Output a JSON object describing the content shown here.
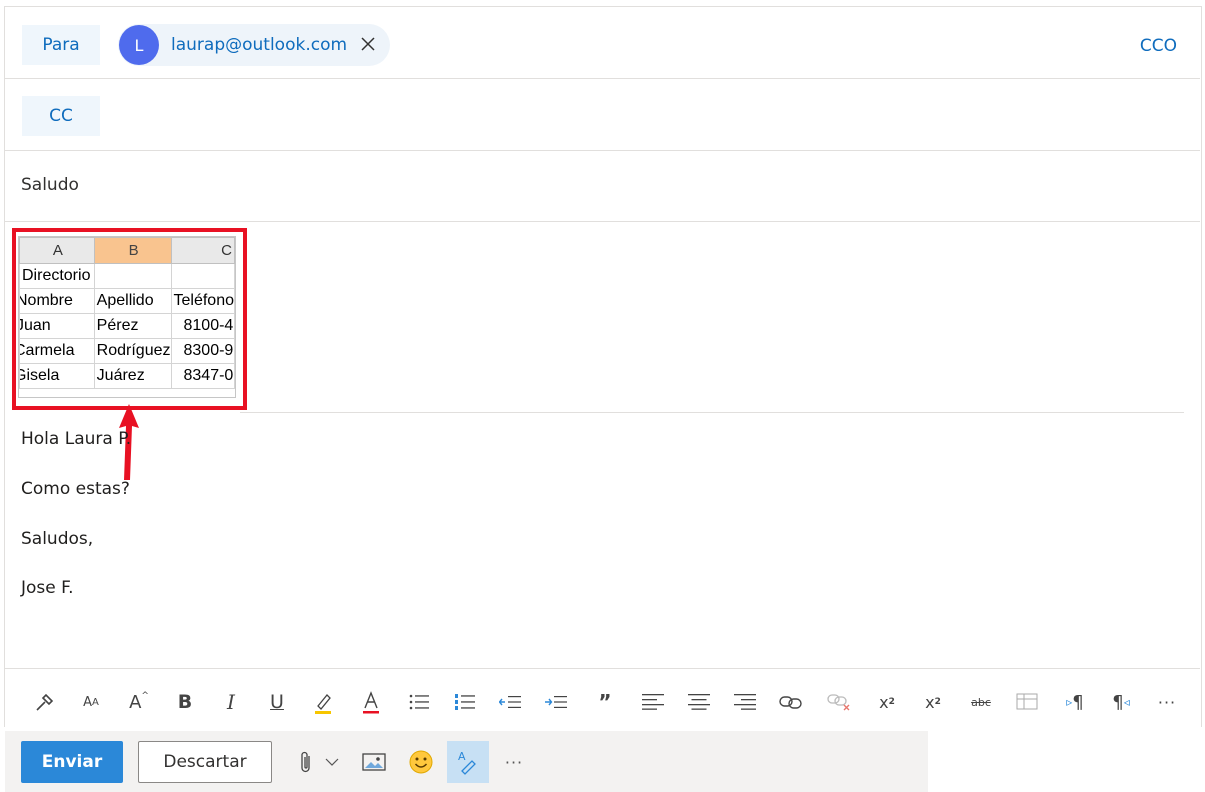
{
  "to_row": {
    "label": "Para",
    "recipient_initial": "L",
    "recipient_email": "laurap@outlook.com",
    "bcc_label": "CCO"
  },
  "cc_row": {
    "label": "CC"
  },
  "subject": "Saludo",
  "spreadsheet": {
    "columns": [
      "A",
      "B",
      "C"
    ],
    "selected_column": "B",
    "rows": [
      [
        "Directorio",
        "",
        ""
      ],
      [
        "Nombre",
        "Apellido",
        "Teléfono"
      ],
      [
        "Juan",
        "Pérez",
        "8100-4"
      ],
      [
        "Carmela",
        "Rodríguez",
        "8300-9"
      ],
      [
        "Gisela",
        "Juárez",
        "8347-0"
      ]
    ]
  },
  "body": {
    "greeting": "Hola Laura P.",
    "line2": "Como estas?",
    "closing": "Saludos,",
    "signature": "Jose F."
  },
  "actions": {
    "send_label": "Enviar",
    "discard_label": "Descartar"
  },
  "colors": {
    "accent": "#0f6cbd",
    "send_button": "#2b88d8",
    "highlight_box": "#e81123"
  }
}
